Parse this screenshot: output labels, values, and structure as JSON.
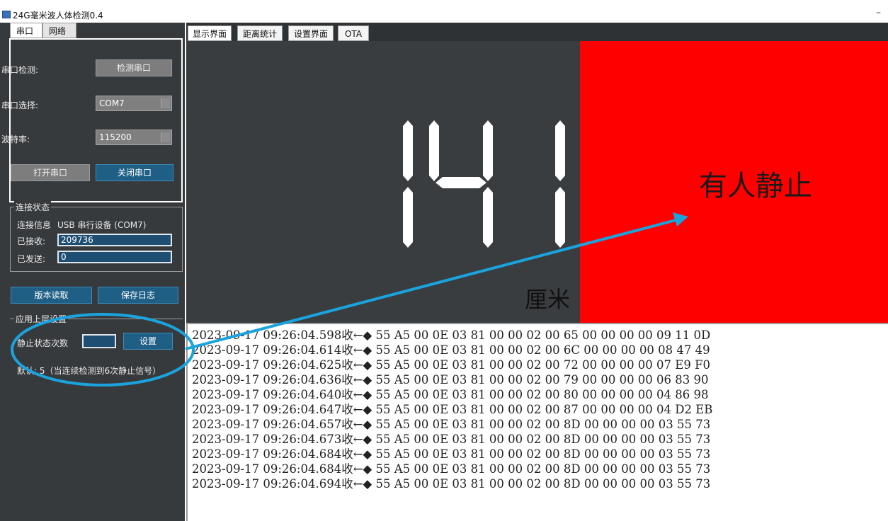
{
  "window": {
    "title": "24G毫米波人体检测0.4",
    "minimize": "–"
  },
  "left_tabs": [
    "串口",
    "网络"
  ],
  "serial": {
    "detect_label": "串口检测:",
    "detect_button": "检测串口",
    "select_label": "串口选择:",
    "port_value": "COM7",
    "baud_label": "波特率:",
    "baud_value": "115200",
    "open_button": "打开串口",
    "close_button": "关闭串口"
  },
  "connection": {
    "title": "连接状态",
    "info_label": "连接信息",
    "info_value": "USB 串行设备 (COM7)",
    "received_label": "已接收:",
    "received_value": "209736",
    "sent_label": "已发送:",
    "sent_value": "0"
  },
  "actions": {
    "read_version": "版本读取",
    "save_log": "保存日志"
  },
  "app_settings": {
    "title": "应用上层设置",
    "still_count_label": "静止状态次数",
    "still_count_value": "",
    "set_button": "设置",
    "default_note": "默认: 5（当连续检测到6次静止信号）"
  },
  "right_tabs": [
    "显示界面",
    "距离统计",
    "设置界面",
    "OTA"
  ],
  "display": {
    "distance": "141",
    "unit": "厘米",
    "status": "有人静止",
    "status_color": "#ff0000"
  },
  "log_lines": [
    "2023-09-17 09:26:04.598收←◆ 55 A5 00 0E 03 81 00 00 02 00 65 00 00 00 00 09 11 0D",
    "2023-09-17 09:26:04.614收←◆ 55 A5 00 0E 03 81 00 00 02 00 6C 00 00 00 00 08 47 49",
    "2023-09-17 09:26:04.625收←◆ 55 A5 00 0E 03 81 00 00 02 00 72 00 00 00 00 07 E9 F0",
    "2023-09-17 09:26:04.636收←◆ 55 A5 00 0E 03 81 00 00 02 00 79 00 00 00 00 06 83 90",
    "2023-09-17 09:26:04.640收←◆ 55 A5 00 0E 03 81 00 00 02 00 80 00 00 00 00 04 86 98",
    "2023-09-17 09:26:04.647收←◆ 55 A5 00 0E 03 81 00 00 02 00 87 00 00 00 00 04 D2 EB",
    "2023-09-17 09:26:04.657收←◆ 55 A5 00 0E 03 81 00 00 02 00 8D 00 00 00 00 03 55 73",
    "2023-09-17 09:26:04.673收←◆ 55 A5 00 0E 03 81 00 00 02 00 8D 00 00 00 00 03 55 73",
    "2023-09-17 09:26:04.684收←◆ 55 A5 00 0E 03 81 00 00 02 00 8D 00 00 00 00 03 55 73",
    "2023-09-17 09:26:04.684收←◆ 55 A5 00 0E 03 81 00 00 02 00 8D 00 00 00 00 03 55 73",
    "2023-09-17 09:26:04.694收←◆ 55 A5 00 0E 03 81 00 00 02 00 8D 00 00 00 00 03 55 73"
  ],
  "colors": {
    "panel_bg": "#373a3d",
    "accent_blue": "#1f5f86",
    "annotation": "#1aa3dd"
  }
}
